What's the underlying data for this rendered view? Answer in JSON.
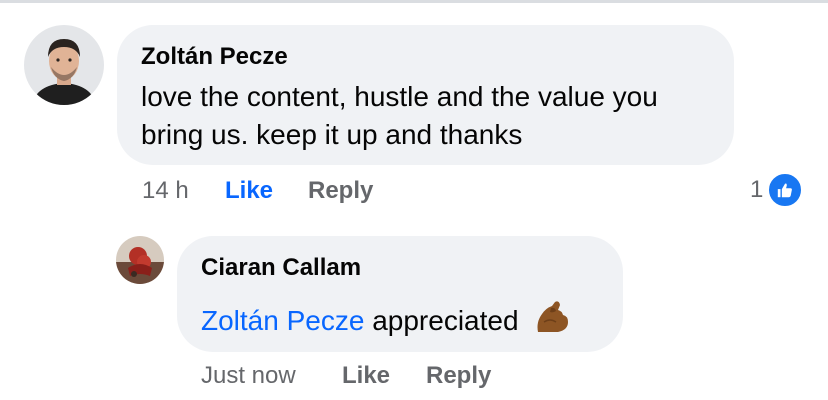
{
  "comment": {
    "author": "Zoltán Pecze",
    "text_line1": "love the content, hustle and the value you",
    "text_line2": "bring us. keep it up and thanks",
    "time": "14 h",
    "like_label": "Like",
    "reply_label": "Reply",
    "reaction_count": "1",
    "reaction_icon": "thumbs-up-icon",
    "accent_color": "#0866ff",
    "bubble_color": "#f0f2f5",
    "meta_color": "#65676b"
  },
  "reply": {
    "author": "Ciaran Callam",
    "mention": "Zoltán Pecze",
    "text": "appreciated",
    "emoji": "flexed-biceps-icon",
    "time": "Just now",
    "like_label": "Like",
    "reply_label": "Reply"
  }
}
